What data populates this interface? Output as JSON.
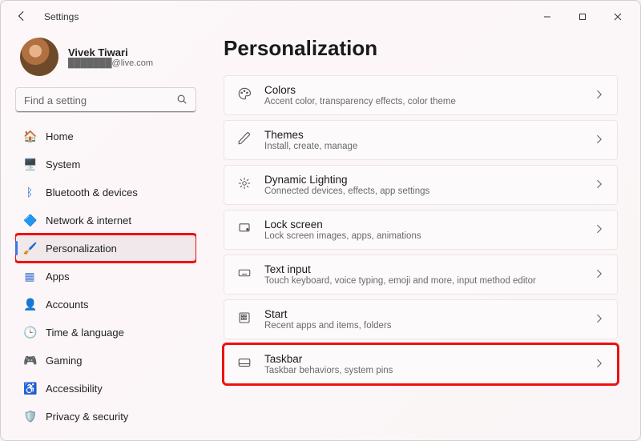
{
  "app": {
    "title": "Settings"
  },
  "profile": {
    "name": "Vivek Tiwari",
    "email": "███████@live.com"
  },
  "search": {
    "placeholder": "Find a setting"
  },
  "nav": [
    {
      "icon": "🏠",
      "label": "Home",
      "id": "home"
    },
    {
      "icon": "🖥️",
      "label": "System",
      "id": "system"
    },
    {
      "icon": "ᛒ",
      "label": "Bluetooth & devices",
      "id": "bluetooth",
      "iconColor": "#1f6fd0"
    },
    {
      "icon": "🔷",
      "label": "Network & internet",
      "id": "network"
    },
    {
      "icon": "🖌️",
      "label": "Personalization",
      "id": "personalization",
      "selected": true,
      "highlight": true
    },
    {
      "icon": "▦",
      "label": "Apps",
      "id": "apps",
      "iconColor": "#4a7bd0"
    },
    {
      "icon": "�small",
      "label": "Accounts",
      "id": "accounts",
      "iconRaw": "•"
    },
    {
      "icon": "🕒",
      "label": "Time & language",
      "id": "time"
    },
    {
      "icon": "🎮",
      "label": "Gaming",
      "id": "gaming"
    },
    {
      "icon": "♿",
      "label": "Accessibility",
      "id": "accessibility",
      "iconColor": "#2a7bbf"
    },
    {
      "icon": "🛡️",
      "label": "Privacy & security",
      "id": "privacy"
    }
  ],
  "page": {
    "title": "Personalization"
  },
  "cards": [
    {
      "icon": "palette",
      "title": "Colors",
      "sub": "Accent color, transparency effects, color theme"
    },
    {
      "icon": "pen",
      "title": "Themes",
      "sub": "Install, create, manage"
    },
    {
      "icon": "spark",
      "title": "Dynamic Lighting",
      "sub": "Connected devices, effects, app settings"
    },
    {
      "icon": "lock",
      "title": "Lock screen",
      "sub": "Lock screen images, apps, animations"
    },
    {
      "icon": "keyboard",
      "title": "Text input",
      "sub": "Touch keyboard, voice typing, emoji and more, input method editor"
    },
    {
      "icon": "grid",
      "title": "Start",
      "sub": "Recent apps and items, folders"
    },
    {
      "icon": "taskbar",
      "title": "Taskbar",
      "sub": "Taskbar behaviors, system pins",
      "highlight": true
    }
  ]
}
